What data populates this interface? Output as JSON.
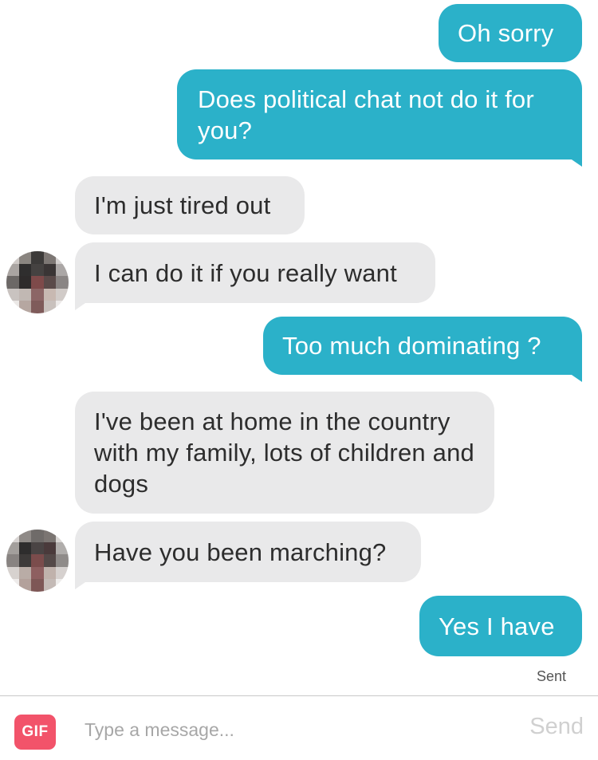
{
  "messages": [
    {
      "id": "m1",
      "direction": "outgoing",
      "text": "Oh sorry"
    },
    {
      "id": "m2",
      "direction": "outgoing",
      "text": "Does political chat not do it for you?"
    },
    {
      "id": "m3",
      "direction": "incoming",
      "text": "I'm just tired out"
    },
    {
      "id": "m4",
      "direction": "incoming",
      "text": "I can do it if you really want"
    },
    {
      "id": "m5",
      "direction": "outgoing",
      "text": "Too much dominating ?"
    },
    {
      "id": "m6",
      "direction": "incoming",
      "text": "I've been at home in the country with my family, lots of children and dogs"
    },
    {
      "id": "m7",
      "direction": "incoming",
      "text": "Have you been marching?"
    },
    {
      "id": "m8",
      "direction": "outgoing",
      "text": "Yes I have"
    }
  ],
  "status": {
    "sent_label": "Sent"
  },
  "composer": {
    "gif_label": "GIF",
    "placeholder": "Type a message...",
    "send_label": "Send"
  },
  "colors": {
    "outgoing_bubble": "#2bb1c9",
    "incoming_bubble": "#e9e9ea",
    "gif_button": "#f2536a",
    "send_disabled": "#d0d0d0"
  },
  "icons": {
    "avatar": "pixelated-contact-avatar"
  }
}
